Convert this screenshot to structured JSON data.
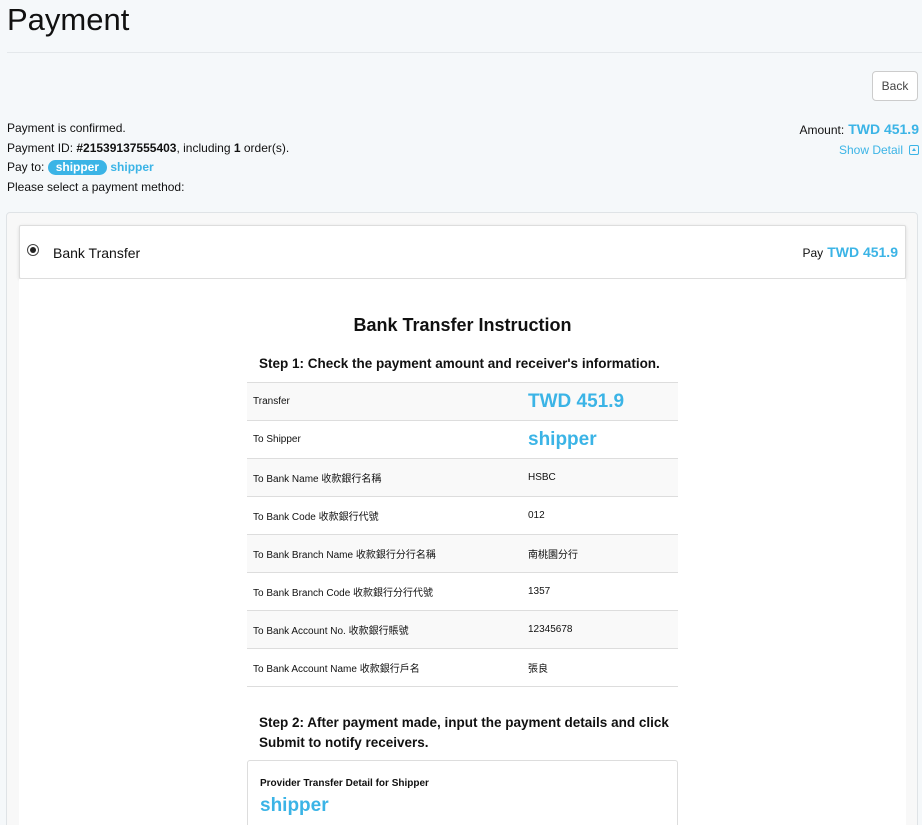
{
  "page": {
    "title": "Payment"
  },
  "toolbar": {
    "back_label": "Back"
  },
  "info": {
    "confirmed_text": "Payment is confirmed.",
    "payment_id_prefix": "Payment ID: ",
    "payment_id": "#21539137555403",
    "including_text": ", including ",
    "order_count": "1",
    "order_suffix": " order(s).",
    "pay_to_label": "Pay to: ",
    "pay_to_badge": "shipper",
    "pay_to_name": "shipper",
    "select_prompt": "Please select a payment method:"
  },
  "amount": {
    "label": "Amount:",
    "value": "TWD 451.9",
    "show_detail_label": "Show Detail",
    "show_detail_icon": "chevron-up-square-icon"
  },
  "method": {
    "label": "Bank Transfer",
    "selected": true,
    "pay_label": "Pay",
    "pay_amount": "TWD 451.9"
  },
  "instruction": {
    "title": "Bank Transfer Instruction",
    "step1": "Step 1: Check the payment amount and receiver's information.",
    "rows": [
      {
        "label": "Transfer",
        "value": "TWD 451.9"
      },
      {
        "label": "To Shipper",
        "value": "shipper"
      },
      {
        "label": "To Bank Name 收款銀行名稱",
        "value": "HSBC"
      },
      {
        "label": "To Bank Code 收款銀行代號",
        "value": "012"
      },
      {
        "label": "To Bank Branch Name 收款銀行分行名稱",
        "value": "南桃園分行"
      },
      {
        "label": "To Bank Branch Code 收款銀行分行代號",
        "value": "1357"
      },
      {
        "label": "To Bank Account No. 收款銀行賬號",
        "value": "12345678"
      },
      {
        "label": "To Bank Account Name 收款銀行戶名",
        "value": "張良"
      }
    ],
    "step2": "Step 2: After payment made, input the payment details and click Submit to notify receivers.",
    "provider_label": "Provider Transfer Detail for Shipper",
    "provider_name": "shipper"
  },
  "colors": {
    "accent": "#3bb4e6",
    "background": "#f5f8fa"
  }
}
